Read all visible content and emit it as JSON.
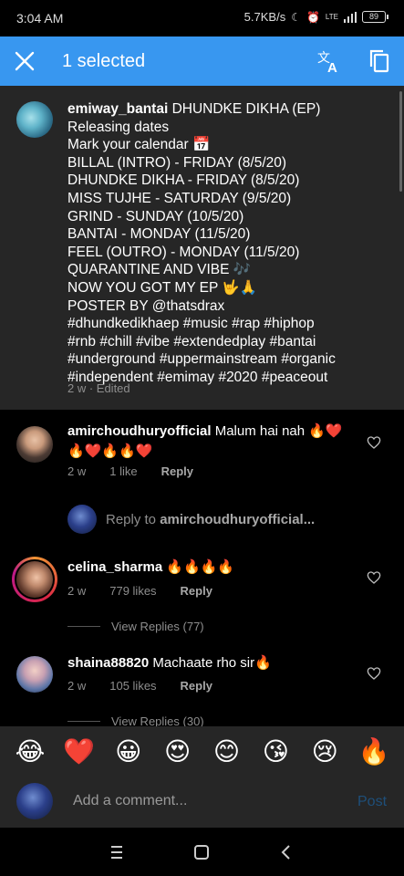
{
  "status": {
    "time": "3:04 AM",
    "net_speed": "5.7KB/s",
    "battery": "89",
    "net_label": "LTE"
  },
  "action_bar": {
    "title": "1 selected"
  },
  "caption": {
    "username": "emiway_bantai",
    "lines": [
      "DHUNDKE DIKHA (EP)",
      "Releasing dates",
      "Mark your calendar 📅",
      "BILLAL (INTRO) - FRIDAY (8/5/20)",
      "DHUNDKE DIKHA - FRIDAY (8/5/20)",
      "MISS TUJHE - SATURDAY (9/5/20)",
      "GRIND - SUNDAY (10/5/20)",
      "BANTAI - MONDAY (11/5/20)",
      "FEEL (OUTRO) - MONDAY (11/5/20)",
      "QUARANTINE AND VIBE 🎶",
      "NOW YOU GOT MY EP 🤟🙏",
      "POSTER BY @thatsdrax",
      "#dhundkedikhaep #music #rap #hiphop",
      "#rnb #chill #vibe #extendedplay #bantai",
      "#underground #uppermainstream #organic",
      "#independent #emimay #2020 #peaceout"
    ],
    "meta": "2 w · Edited"
  },
  "comments": [
    {
      "username": "amirchoudhuryofficial",
      "text": "Malum hai nah 🔥❤️🔥❤️🔥🔥❤️",
      "age": "2 w",
      "likes": "1 like",
      "reply": "Reply"
    },
    {
      "username": "celina_sharma",
      "text": "🔥🔥🔥🔥",
      "age": "2 w",
      "likes": "779 likes",
      "reply": "Reply"
    },
    {
      "username": "shaina88820",
      "text": "Machaate rho sir🔥",
      "age": "2 w",
      "likes": "105 likes",
      "reply": "Reply"
    }
  ],
  "reply_to": {
    "prefix": "Reply to",
    "username": "amirchoudhuryofficial..."
  },
  "view_replies": [
    "View Replies (77)",
    "View Replies (30)"
  ],
  "emoji_bar": [
    "😂",
    "❤️",
    "😀",
    "😍",
    "😊",
    "😘",
    "😢",
    "🔥"
  ],
  "comment_input": {
    "placeholder": "Add a comment...",
    "post_label": "Post"
  },
  "colors": {
    "accent": "#3897f0",
    "surface": "#262626",
    "background": "#000000",
    "muted_text": "#8e8e8e"
  }
}
